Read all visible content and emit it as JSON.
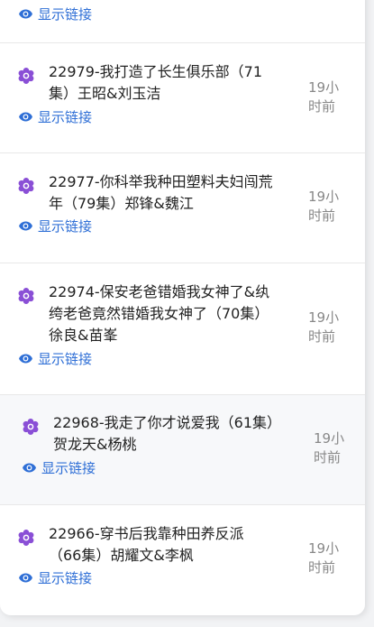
{
  "link_label": "显示链接",
  "items": [
    {
      "title": "22979-我打造了长生俱乐部（71集）王昭&刘玉洁",
      "time": "19小时前"
    },
    {
      "title": "22977-你科举我种田塑料夫妇闯荒年（79集）郑锋&魏江",
      "time": "19小时前"
    },
    {
      "title": "22974-保安老爸错婚我女神了&纨绔老爸竟然错婚我女神了（70集）徐良&苗峯",
      "time": "19小时前"
    },
    {
      "title": "22968-我走了你才说爱我（61集）贺龙天&杨桃",
      "time": "19小时前"
    },
    {
      "title": "22966-穿书后我靠种田养反派（66集）胡耀文&李枫",
      "time": "19小时前"
    }
  ],
  "colors": {
    "link": "#2f6fd6",
    "flower": "#8a4fd6",
    "title": "#222222",
    "time": "#888888"
  }
}
